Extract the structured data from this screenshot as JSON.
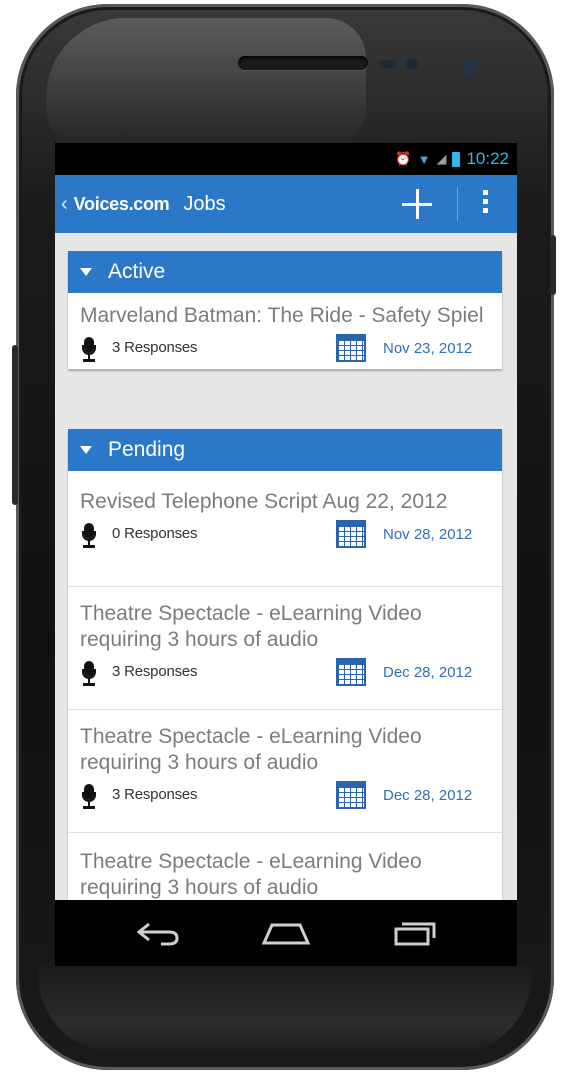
{
  "status_bar": {
    "time": "10:22"
  },
  "action_bar": {
    "back_glyph": "‹",
    "logo": "Voices.com",
    "title": "Jobs"
  },
  "sections": [
    {
      "label": "Active",
      "jobs": [
        {
          "title": "Marveland Batman: The Ride - Safety Spiel",
          "responses": "3 Responses",
          "date": "Nov 23, 2012"
        }
      ]
    },
    {
      "label": "Pending",
      "jobs": [
        {
          "title": "Revised Telephone Script Aug 22, 2012",
          "responses": "0 Responses",
          "date": "Nov 28, 2012"
        },
        {
          "title": "Theatre Spectacle - eLearning Video requiring 3 hours of audio",
          "responses": "3 Responses",
          "date": "Dec 28, 2012"
        },
        {
          "title": "Theatre Spectacle - eLearning Video requiring 3 hours of audio",
          "responses": "3 Responses",
          "date": "Dec 28, 2012"
        },
        {
          "title": "Theatre Spectacle - eLearning Video requiring 3 hours of audio",
          "responses": "",
          "date": ""
        }
      ]
    }
  ],
  "colors": {
    "accent": "#2c78c8",
    "date_text": "#2f6fb8",
    "status_blue": "#33b5e5"
  },
  "icons": [
    "alarm-icon",
    "wifi-icon",
    "signal-icon",
    "battery-icon",
    "add-icon",
    "overflow-menu-icon",
    "microphone-icon",
    "calendar-icon",
    "back-nav-icon",
    "home-nav-icon",
    "recents-nav-icon"
  ]
}
